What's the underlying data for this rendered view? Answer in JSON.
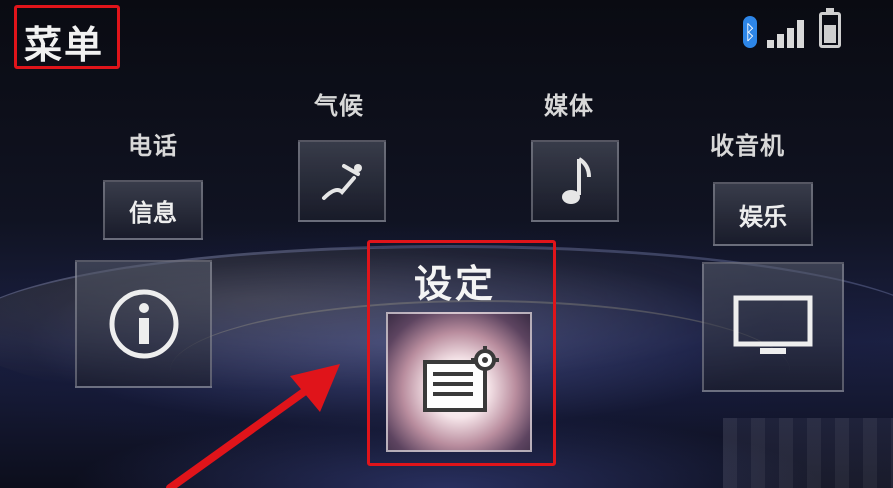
{
  "header": {
    "title": "菜单"
  },
  "status_bar": {
    "icons": [
      "bluetooth-icon",
      "signal-icon",
      "battery-icon"
    ]
  },
  "menu": {
    "phone_label": "电话",
    "climate_label": "气候",
    "media_label": "媒体",
    "radio_label": "收音机",
    "info_label": "信息",
    "entertainment_label": "娱乐",
    "settings_label": "设定"
  },
  "icons": {
    "info": "info-icon",
    "climate": "seat-climate-icon",
    "media": "music-note-icon",
    "display": "monitor-icon",
    "settings": "settings-document-gear-icon"
  },
  "colors": {
    "highlight_box": "#e0141a",
    "arrow": "#e0141a",
    "bluetooth": "#2d86e8"
  }
}
